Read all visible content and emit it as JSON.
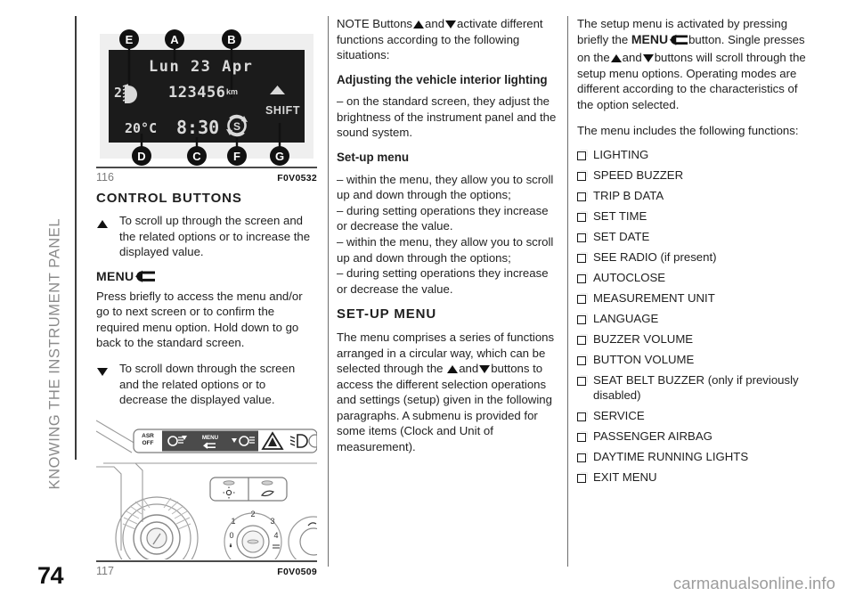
{
  "sidebar": {
    "chapter_title": "KNOWING THE INSTRUMENT PANEL"
  },
  "page_number": "74",
  "watermark": "carmanualsonline.info",
  "figures": {
    "cluster": {
      "number": "116",
      "code": "F0V0532",
      "callouts": [
        "E",
        "A",
        "B",
        "D",
        "C",
        "F",
        "G"
      ],
      "display": {
        "date": "Lun 23 Apr",
        "lighting_level": "2",
        "odometer": "123456",
        "odometer_unit": "km",
        "temperature": "20°C",
        "clock": "8:30",
        "shift_label": "SHIFT",
        "start_stop_icon": "S"
      }
    },
    "controls": {
      "number": "117",
      "code": "F0V0509",
      "button_labels": [
        "ASR OFF",
        "MENU"
      ],
      "dial_ticks": [
        "0",
        "1",
        "2",
        "3",
        "4"
      ]
    }
  },
  "left_column": {
    "heading": "CONTROL BUTTONS",
    "scroll_up": {
      "icon": "triangle-up-icon",
      "text": "To scroll up through the screen and the related options or to increase the displayed value."
    },
    "menu": {
      "label": "MENU",
      "icon": "menu-return-arrow-icon",
      "text": "Press briefly to access the menu and/or go to next screen or to confirm the required menu option. Hold down to go back to the standard screen."
    },
    "scroll_down": {
      "icon": "triangle-down-icon",
      "text": "To scroll down through the screen and the related options or to decrease the displayed value."
    }
  },
  "mid_column": {
    "note_prefix": "NOTE Buttons",
    "note_mid": "and",
    "note_suffix": "activate different functions according to the following situations:",
    "heading_lighting": "Adjusting the vehicle interior lighting",
    "lighting_text": "– on the standard screen, they adjust the brightness of the instrument panel and the sound system.",
    "heading_setup": "Set-up menu",
    "setup_lines": [
      "– within the menu, they allow you to scroll up and down through the options;",
      "– during setting operations they increase or decrease the value.",
      "– within the menu, they allow you to scroll up and down through the options;",
      "– during setting operations they increase or decrease the value."
    ],
    "heading_setup_menu": "SET-UP MENU",
    "setup_menu_text_1": "The menu comprises a series of functions arranged in a circular way, which can be selected through the",
    "setup_menu_text_2": "and",
    "setup_menu_text_3": "buttons to access the different selection operations and settings (setup) given in the following paragraphs. A submenu is provided for some items (Clock and Unit of measurement)."
  },
  "right_column": {
    "intro_1": "The setup menu is activated by pressing briefly the",
    "intro_menu_label": "MENU",
    "intro_2": "button. Single presses on the",
    "intro_3": "and",
    "intro_4": "buttons will scroll through the setup menu options. Operating modes are different according to the characteristics of the option selected.",
    "intro_5": "The menu includes the following functions:",
    "menu_items": [
      "LIGHTING",
      "SPEED BUZZER",
      "TRIP B DATA",
      "SET TIME",
      "SET DATE",
      "SEE RADIO (if present)",
      "AUTOCLOSE",
      "MEASUREMENT UNIT",
      "LANGUAGE",
      "BUZZER VOLUME",
      "BUTTON VOLUME",
      "SEAT BELT BUZZER (only if previously disabled)",
      "SERVICE",
      "PASSENGER AIRBAG",
      "DAYTIME RUNNING LIGHTS",
      "EXIT MENU"
    ]
  },
  "colors": {
    "text": "#1f1f1f",
    "muted": "#8b8b8b",
    "display_bg": "#1b1b1b",
    "display_fg": "#d9d9d9"
  }
}
